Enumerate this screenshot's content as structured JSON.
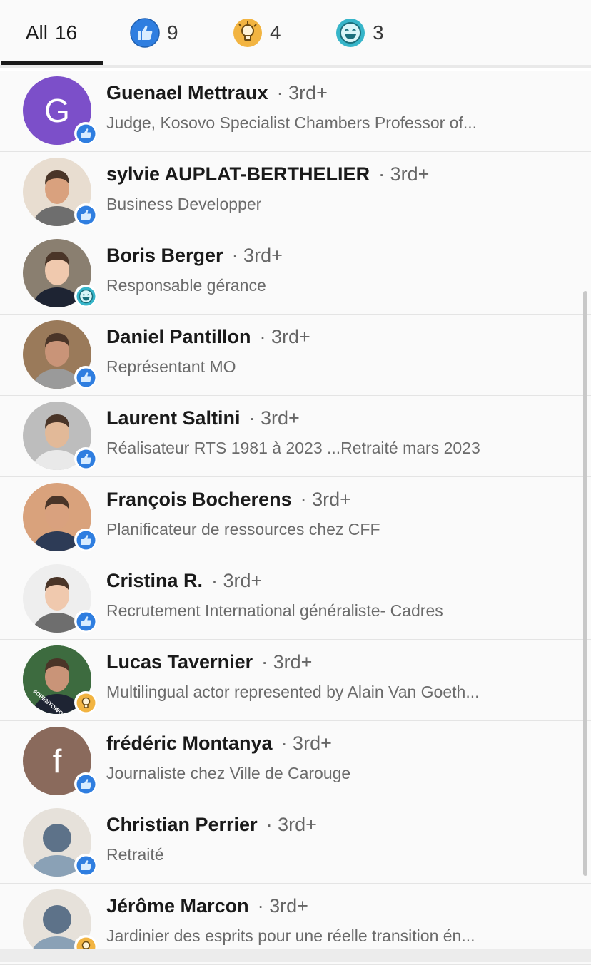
{
  "tabs": [
    {
      "label": "All",
      "count": "16",
      "icon": ""
    },
    {
      "label": "",
      "count": "9",
      "icon": "like-icon"
    },
    {
      "label": "",
      "count": "4",
      "icon": "insightful-icon"
    },
    {
      "label": "",
      "count": "3",
      "icon": "funny-icon"
    }
  ],
  "colors": {
    "like": "#2f7ee0",
    "insightful": "#f2b441",
    "funny": "#36b5c9",
    "tab_active": "#1a1a1a"
  },
  "reactors": [
    {
      "name": "Guenael Mettraux",
      "degree": "· 3rd+",
      "headline": "Judge, Kosovo Specialist Chambers Professor of...",
      "avatar_letter": "G",
      "avatar_color": "#7c4fc9",
      "reaction": "like-icon"
    },
    {
      "name": "sylvie AUPLAT-BERTHELIER",
      "degree": "· 3rd+",
      "headline": "Business Developper",
      "avatar_letter": "",
      "avatar_color": "#e8ddd0",
      "reaction": "like-icon"
    },
    {
      "name": "Boris Berger",
      "degree": "· 3rd+",
      "headline": "Responsable gérance",
      "avatar_letter": "",
      "avatar_color": "#8a7f70",
      "reaction": "funny-icon"
    },
    {
      "name": "Daniel Pantillon",
      "degree": "· 3rd+",
      "headline": "Représentant MO",
      "avatar_letter": "",
      "avatar_color": "#9a7a5a",
      "reaction": "like-icon"
    },
    {
      "name": "Laurent Saltini",
      "degree": "· 3rd+",
      "headline": "Réalisateur RTS 1981 à 2023 ...Retraité mars 2023",
      "avatar_letter": "",
      "avatar_color": "#bdbdbd",
      "reaction": "like-icon"
    },
    {
      "name": "François Bocherens",
      "degree": "· 3rd+",
      "headline": "Planificateur de ressources chez CFF",
      "avatar_letter": "",
      "avatar_color": "#d9a27c",
      "reaction": "like-icon"
    },
    {
      "name": "Cristina R.",
      "degree": "· 3rd+",
      "headline": "Recrutement International généraliste- Cadres",
      "avatar_letter": "",
      "avatar_color": "#eeeeee",
      "reaction": "like-icon"
    },
    {
      "name": "Lucas Tavernier",
      "degree": "· 3rd+",
      "headline": "Multilingual actor represented by Alain Van Goeth...",
      "avatar_letter": "",
      "avatar_color": "#3d6b3f",
      "reaction": "insightful-icon",
      "ring_text": "#OPENTOWORK"
    },
    {
      "name": "frédéric Montanya",
      "degree": "· 3rd+",
      "headline": "Journaliste chez Ville de Carouge",
      "avatar_letter": "f",
      "avatar_color": "#8a6a5c",
      "reaction": "like-icon"
    },
    {
      "name": "Christian Perrier",
      "degree": "· 3rd+",
      "headline": "Retraité",
      "avatar_letter": "",
      "avatar_color": "#e6e1da",
      "reaction": "like-icon"
    },
    {
      "name": "Jérôme Marcon",
      "degree": "· 3rd+",
      "headline": "Jardinier des esprits pour une réelle transition én...",
      "avatar_letter": "",
      "avatar_color": "#e6e1da",
      "reaction": "insightful-icon"
    }
  ]
}
